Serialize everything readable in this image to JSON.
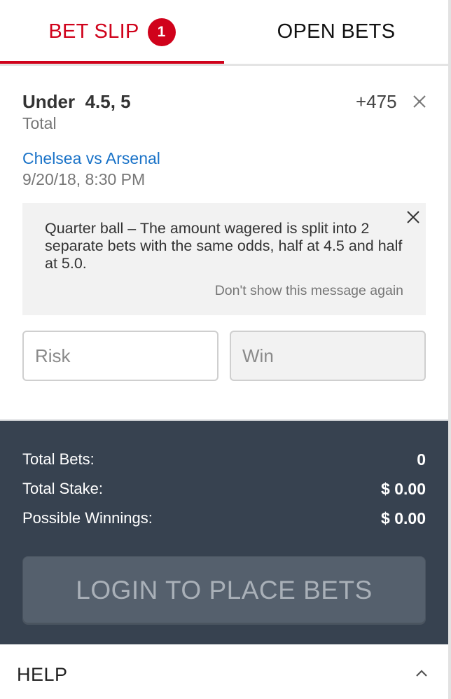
{
  "tabs": {
    "bet_slip_label": "BET SLIP",
    "bet_slip_count": "1",
    "open_bets_label": "OPEN BETS"
  },
  "bet": {
    "selection": "Under  4.5, 5",
    "odds": "+475",
    "market": "Total",
    "event": "Chelsea vs Arsenal",
    "datetime": "9/20/18, 8:30 PM"
  },
  "notice": {
    "text": "Quarter ball – The amount wagered is split into 2 separate bets with the same odds, half at 4.5 and half at 5.0.",
    "dismiss_label": "Don't show this message again"
  },
  "inputs": {
    "risk_placeholder": "Risk",
    "win_placeholder": "Win"
  },
  "summary": {
    "total_bets_label": "Total Bets:",
    "total_bets_value": "0",
    "total_stake_label": "Total Stake:",
    "total_stake_value": "$ 0.00",
    "possible_winnings_label": "Possible Winnings:",
    "possible_winnings_value": "$ 0.00",
    "login_button_label": "LOGIN TO PLACE BETS"
  },
  "help": {
    "label": "HELP",
    "icon": "chevron-up-icon"
  },
  "colors": {
    "accent_red": "#d0021b",
    "link_blue": "#1a73c8",
    "summary_bg": "#374250",
    "button_bg": "#55606d"
  }
}
